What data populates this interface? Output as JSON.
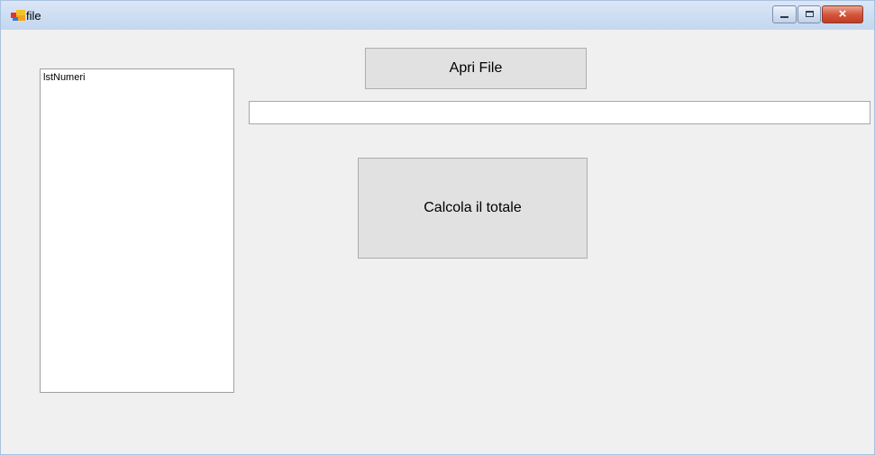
{
  "window": {
    "title": "file"
  },
  "caption_buttons": {
    "minimize": "minimize",
    "maximize": "maximize",
    "close": "×"
  },
  "listbox": {
    "items": [
      "lstNumeri"
    ]
  },
  "textbox": {
    "value": ""
  },
  "buttons": {
    "open_file": "Apri File",
    "compute_total": "Calcola il totale"
  },
  "colors": {
    "form_background": "#f0f0f0",
    "titlebar": "#cfdff3",
    "button_face": "#e1e1e1",
    "close_button": "#c94a31"
  }
}
